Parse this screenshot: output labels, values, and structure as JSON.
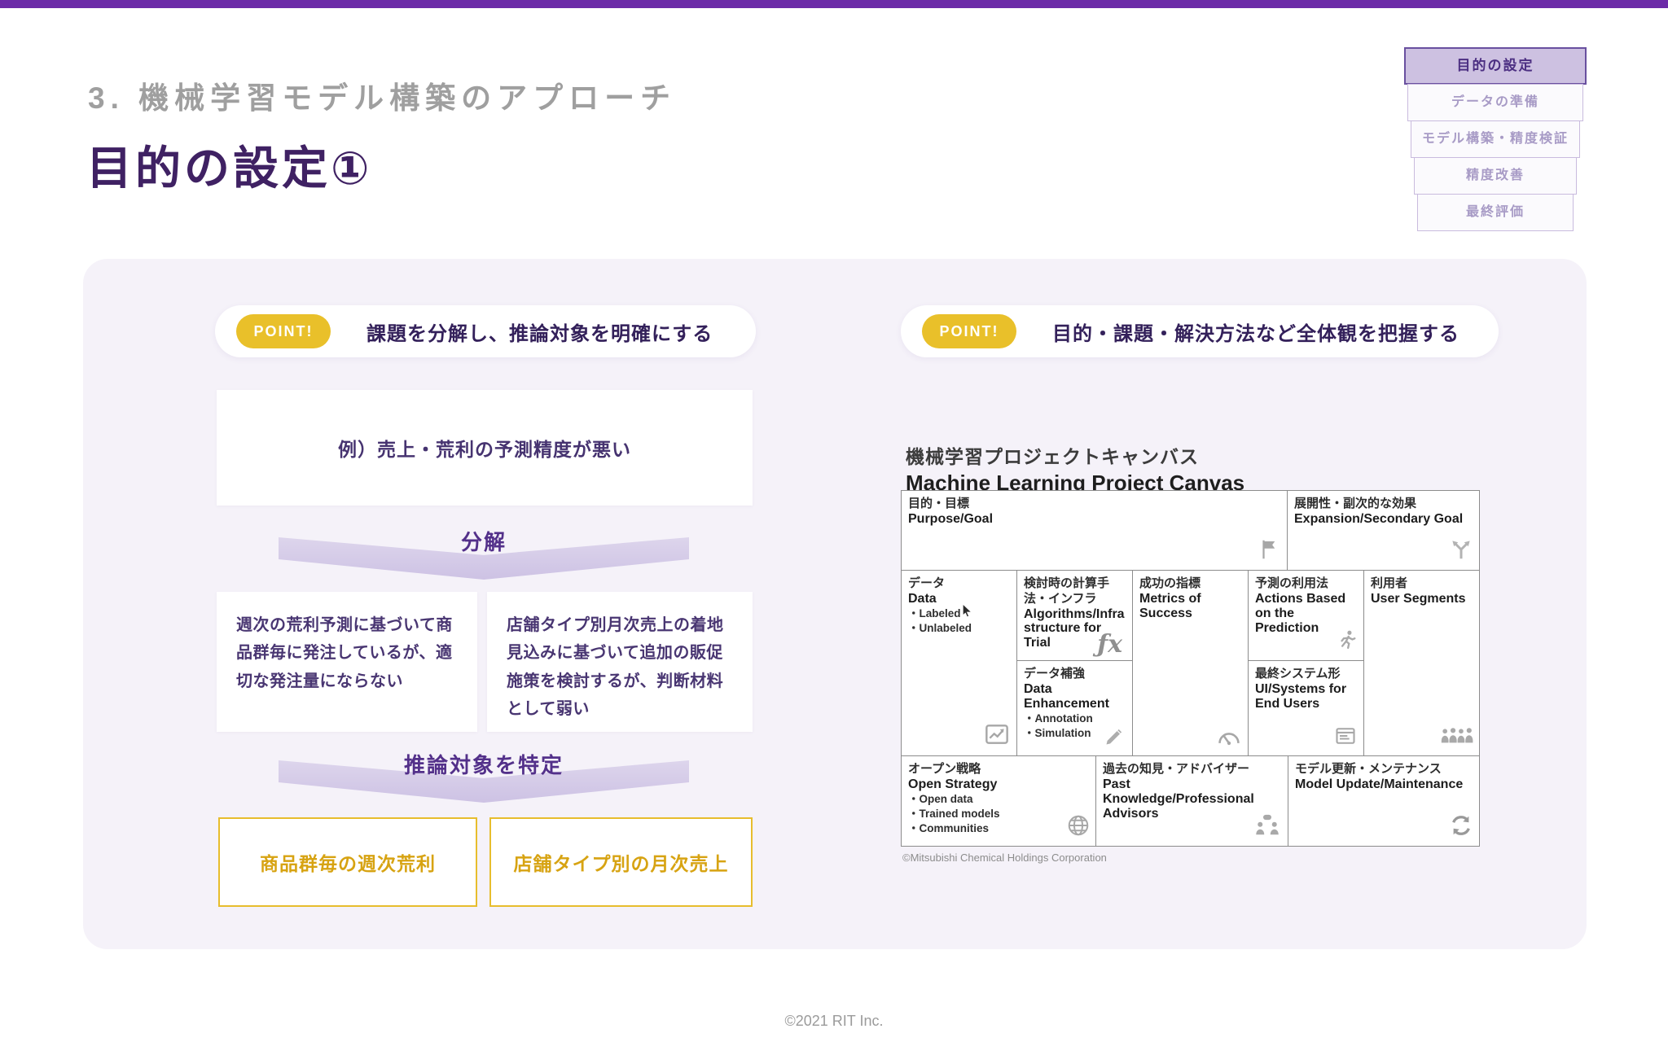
{
  "page": {
    "kicker": "3. 機械学習モデル構築のアプローチ",
    "title": "目的の設定①",
    "footer": "©2021 RIT Inc."
  },
  "colors": {
    "topbar_purple": "#6C2BA8",
    "title_purple": "#3F2163",
    "panel_lavender": "#F5F2F9",
    "badge_yellow": "#E9C02A",
    "target_yellow_text": "#D7A312",
    "arrow_lavender": "#CDC2E4"
  },
  "stepper": {
    "items": [
      {
        "label": "目的の設定",
        "active": true
      },
      {
        "label": "データの準備",
        "active": false
      },
      {
        "label": "モデル構築・精度検証",
        "active": false
      },
      {
        "label": "精度改善",
        "active": false
      },
      {
        "label": "最終評価",
        "active": false
      }
    ]
  },
  "left": {
    "point_label": "POINT!",
    "point_text": "課題を分解し、推論対象を明確にする",
    "problem": "例）売上・荒利の予測精度が悪い",
    "arrow1_label": "分解",
    "causes": [
      "週次の荒利予測に基づいて商品群毎に発注しているが、適切な発注量にならない",
      "店舗タイプ別月次売上の着地見込みに基づいて追加の販促施策を検討するが、判断材料として弱い"
    ],
    "arrow2_label": "推論対象を特定",
    "targets": [
      "商品群毎の週次荒利",
      "店舗タイプ別の月次売上"
    ]
  },
  "right": {
    "point_label": "POINT!",
    "point_text": "目的・課題・解決方法など全体観を把握する",
    "canvas": {
      "title_ja": "機械学習プロジェクトキャンバス",
      "title_en": "Machine Learning Project Canvas",
      "copyright": "©Mitsubishi Chemical Holdings Corporation",
      "cells": {
        "purpose": {
          "ja": "目的・目標",
          "en": "Purpose/Goal"
        },
        "expansion": {
          "ja": "展開性・副次的な効果",
          "en": "Expansion/Secondary Goal"
        },
        "data": {
          "ja": "データ",
          "en": "Data",
          "b1": "・Labeled",
          "b2": "・Unlabeled"
        },
        "algorithms": {
          "ja": "検討時の計算手法・インフラ",
          "en": "Algorithms/Infrastructure for Trial"
        },
        "data_enhancement": {
          "ja": "データ補強",
          "en": "Data Enhancement",
          "b1": "・Annotation",
          "b2": "・Simulation"
        },
        "metrics": {
          "ja": "成功の指標",
          "en": "Metrics of Success"
        },
        "actions": {
          "ja": "予測の利用法",
          "en": "Actions Based on the Prediction"
        },
        "ui_systems": {
          "ja": "最終システム形",
          "en": "UI/Systems for End Users"
        },
        "users": {
          "ja": "利用者",
          "en": "User Segments"
        },
        "open_strategy": {
          "ja": "オープン戦略",
          "en": "Open Strategy",
          "b1": "・Open data",
          "b2": "・Trained models",
          "b3": "・Communities"
        },
        "past_knowledge": {
          "ja": "過去の知見・アドバイザー",
          "en": "Past Knowledge/Professional Advisors"
        },
        "model_update": {
          "ja": "モデル更新・メンテナンス",
          "en": "Model Update/Maintenance"
        }
      }
    }
  }
}
